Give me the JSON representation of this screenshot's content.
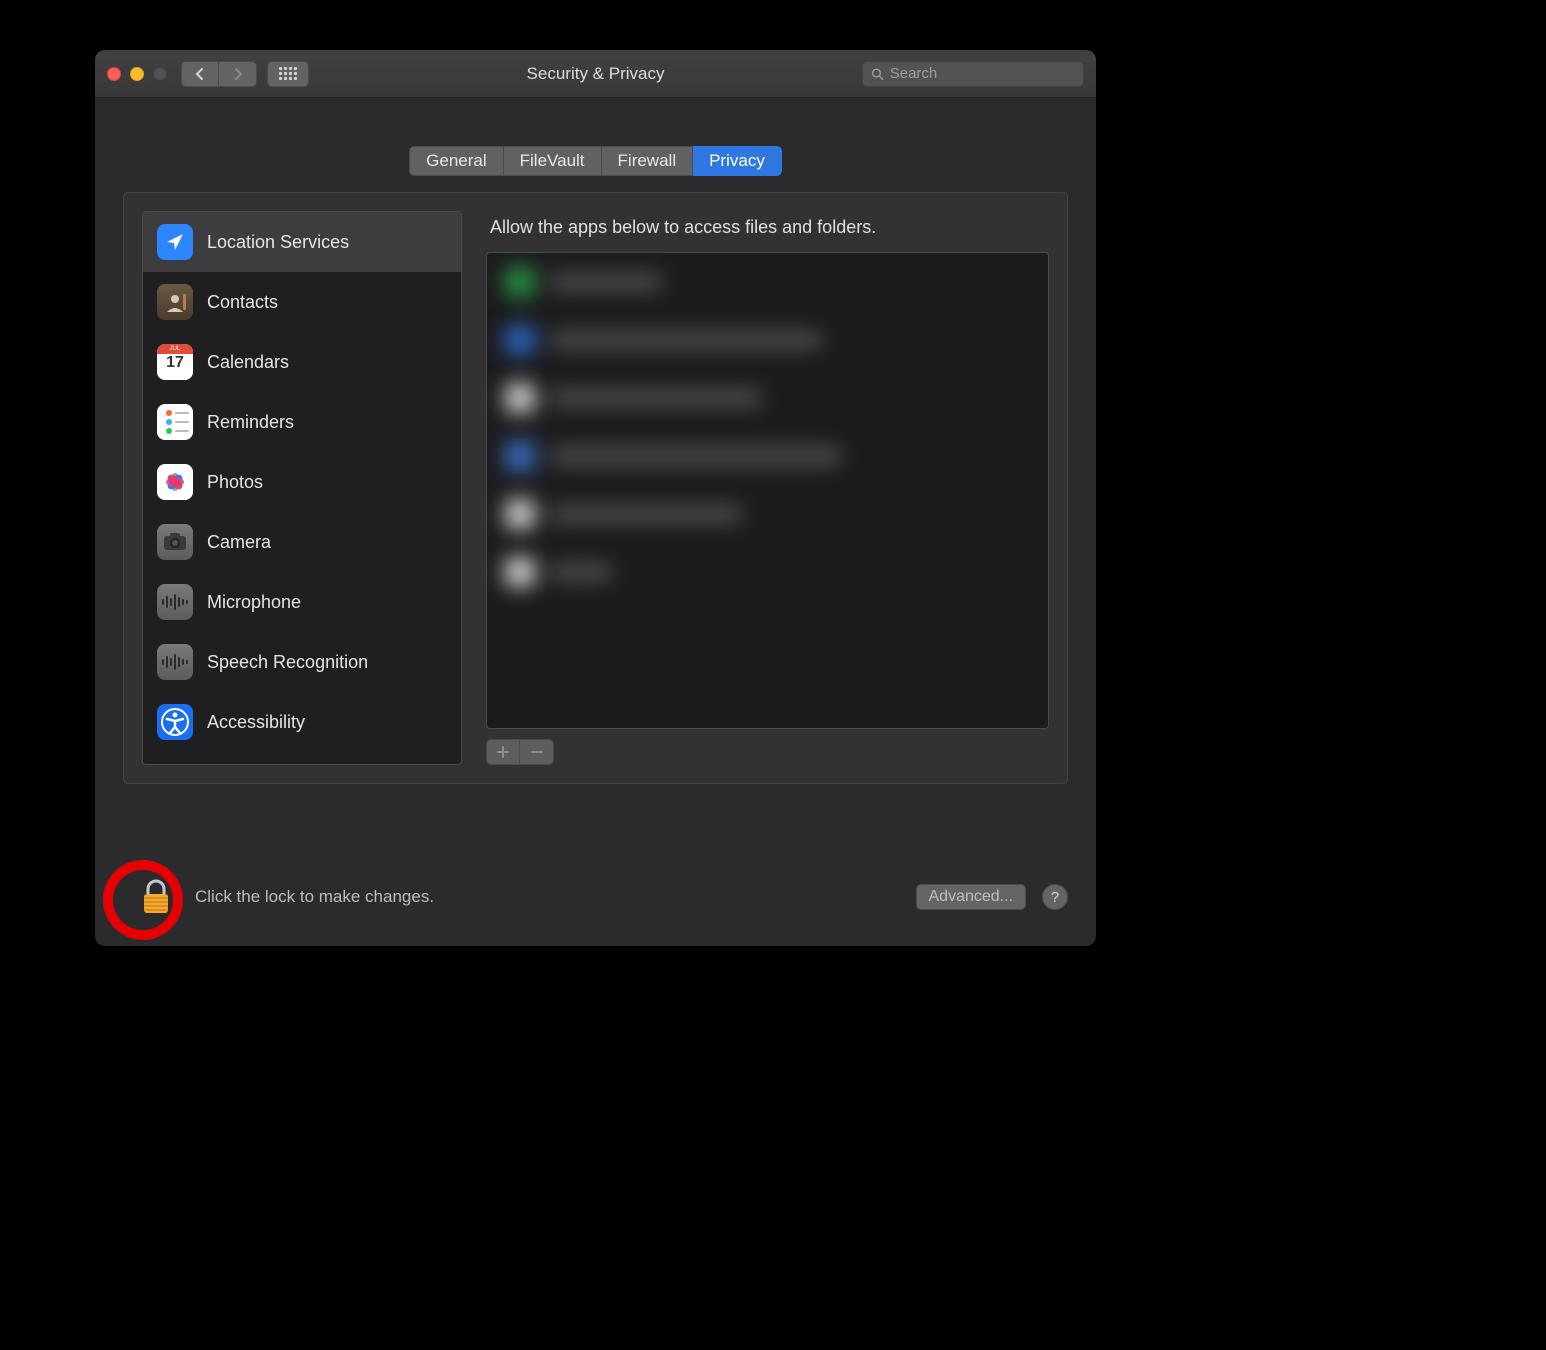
{
  "window": {
    "title": "Security & Privacy"
  },
  "search": {
    "placeholder": "Search",
    "value": ""
  },
  "tabs": [
    {
      "label": "General",
      "active": false
    },
    {
      "label": "FileVault",
      "active": false
    },
    {
      "label": "Firewall",
      "active": false
    },
    {
      "label": "Privacy",
      "active": true
    }
  ],
  "sidebar": {
    "items": [
      {
        "label": "Location Services",
        "icon": "location-icon",
        "selected": true
      },
      {
        "label": "Contacts",
        "icon": "contacts-icon"
      },
      {
        "label": "Calendars",
        "icon": "calendar-icon"
      },
      {
        "label": "Reminders",
        "icon": "reminders-icon"
      },
      {
        "label": "Photos",
        "icon": "photos-icon"
      },
      {
        "label": "Camera",
        "icon": "camera-icon"
      },
      {
        "label": "Microphone",
        "icon": "microphone-icon"
      },
      {
        "label": "Speech Recognition",
        "icon": "speech-icon"
      },
      {
        "label": "Accessibility",
        "icon": "accessibility-icon"
      }
    ]
  },
  "calendar_icon": {
    "month": "JUL",
    "day": "17"
  },
  "main": {
    "description": "Allow the apps below to access files and folders."
  },
  "footer": {
    "lock_text": "Click the lock to make changes.",
    "advanced": "Advanced...",
    "help": "?"
  }
}
